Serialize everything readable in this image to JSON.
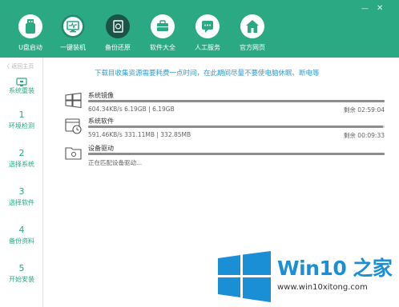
{
  "window": {
    "minimize": "—",
    "close": "✕"
  },
  "nav": [
    {
      "label": "U盘启动",
      "icon": "usb-drive-icon"
    },
    {
      "label": "一键装机",
      "icon": "monitor-icon"
    },
    {
      "label": "备份还原",
      "icon": "backup-restore-icon"
    },
    {
      "label": "软件大全",
      "icon": "briefcase-icon"
    },
    {
      "label": "人工服务",
      "icon": "chat-bubble-icon"
    },
    {
      "label": "官方网页",
      "icon": "home-icon"
    }
  ],
  "sidebar": {
    "back_label": "〈 返回主页",
    "current": {
      "label": "系统重装",
      "icon": "system-reinstall-icon"
    },
    "steps": [
      {
        "num": "1",
        "label": "环境检测"
      },
      {
        "num": "2",
        "label": "选择系统"
      },
      {
        "num": "3",
        "label": "选择软件"
      },
      {
        "num": "4",
        "label": "备份资料"
      },
      {
        "num": "5",
        "label": "开始安装"
      }
    ]
  },
  "notice": "下载目收集资源需要耗费一点时间，在此期间尽量不要使电脑休眠、断电等",
  "tasks": [
    {
      "name": "系统镜像",
      "info": "604.34KB/s 6.19GB | 6.19GB",
      "remaining": "剩余 02:59:04",
      "progress": 1.0,
      "icon": "windows-logo-icon"
    },
    {
      "name": "系统软件",
      "info": "591.46KB/s 331.11MB | 332.85MB",
      "remaining": "剩余 00:09:33",
      "progress": 0.995,
      "icon": "software-clock-icon"
    },
    {
      "name": "设备驱动",
      "info": "正在匹配设备驱动...",
      "remaining": "",
      "progress": 1.0,
      "icon": "driver-folder-icon"
    }
  ],
  "watermark": {
    "title": "Win10 之家",
    "url": "www.win10xitong.com",
    "icon": "windows-logo-icon",
    "color": "#1a8fd6"
  },
  "colors": {
    "header": "#2aa982",
    "accent": "#2aa982",
    "notice": "#2a9dd8"
  }
}
